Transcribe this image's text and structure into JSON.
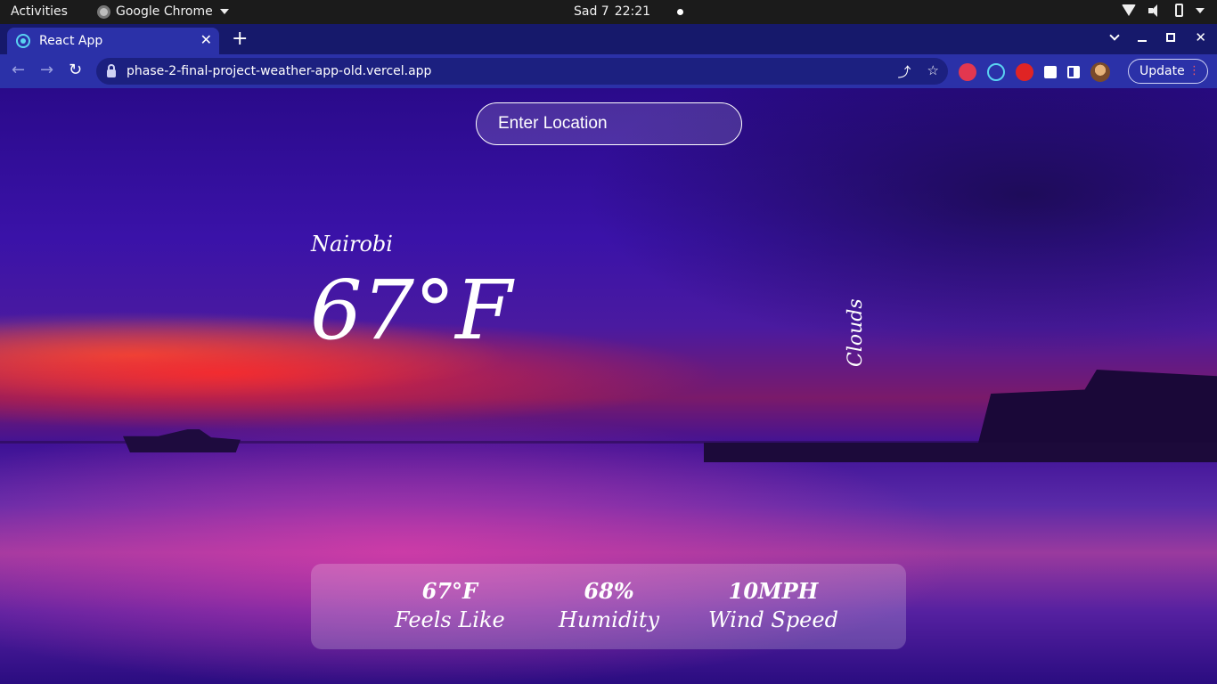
{
  "system_bar": {
    "activities": "Activities",
    "app_name": "Google Chrome",
    "clock_day": "Sad 7",
    "clock_time": "22:21"
  },
  "browser": {
    "tab_title": "React App",
    "url": "phase-2-final-project-weather-app-old.vercel.app",
    "update_label": "Update",
    "icons": [
      "back-icon",
      "forward-icon",
      "reload-icon",
      "lock-icon",
      "share-icon",
      "star-icon",
      "extension-puzzle-icon",
      "side-panel-icon"
    ]
  },
  "app": {
    "search": {
      "placeholder": "Enter Location",
      "value": ""
    },
    "location": "Nairobi",
    "temperature": "67°F",
    "description": "Clouds",
    "stats": [
      {
        "value": "67°F",
        "label": "Feels Like"
      },
      {
        "value": "68%",
        "label": "Humidity"
      },
      {
        "value": "10MPH",
        "label": "Wind Speed"
      }
    ]
  },
  "colors": {
    "tab_strip": "#16196b",
    "toolbar": "#2b31a8",
    "omnibox": "#1c2080",
    "sky_top": "#2a0a8a",
    "sunset_red": "#ff2828"
  }
}
